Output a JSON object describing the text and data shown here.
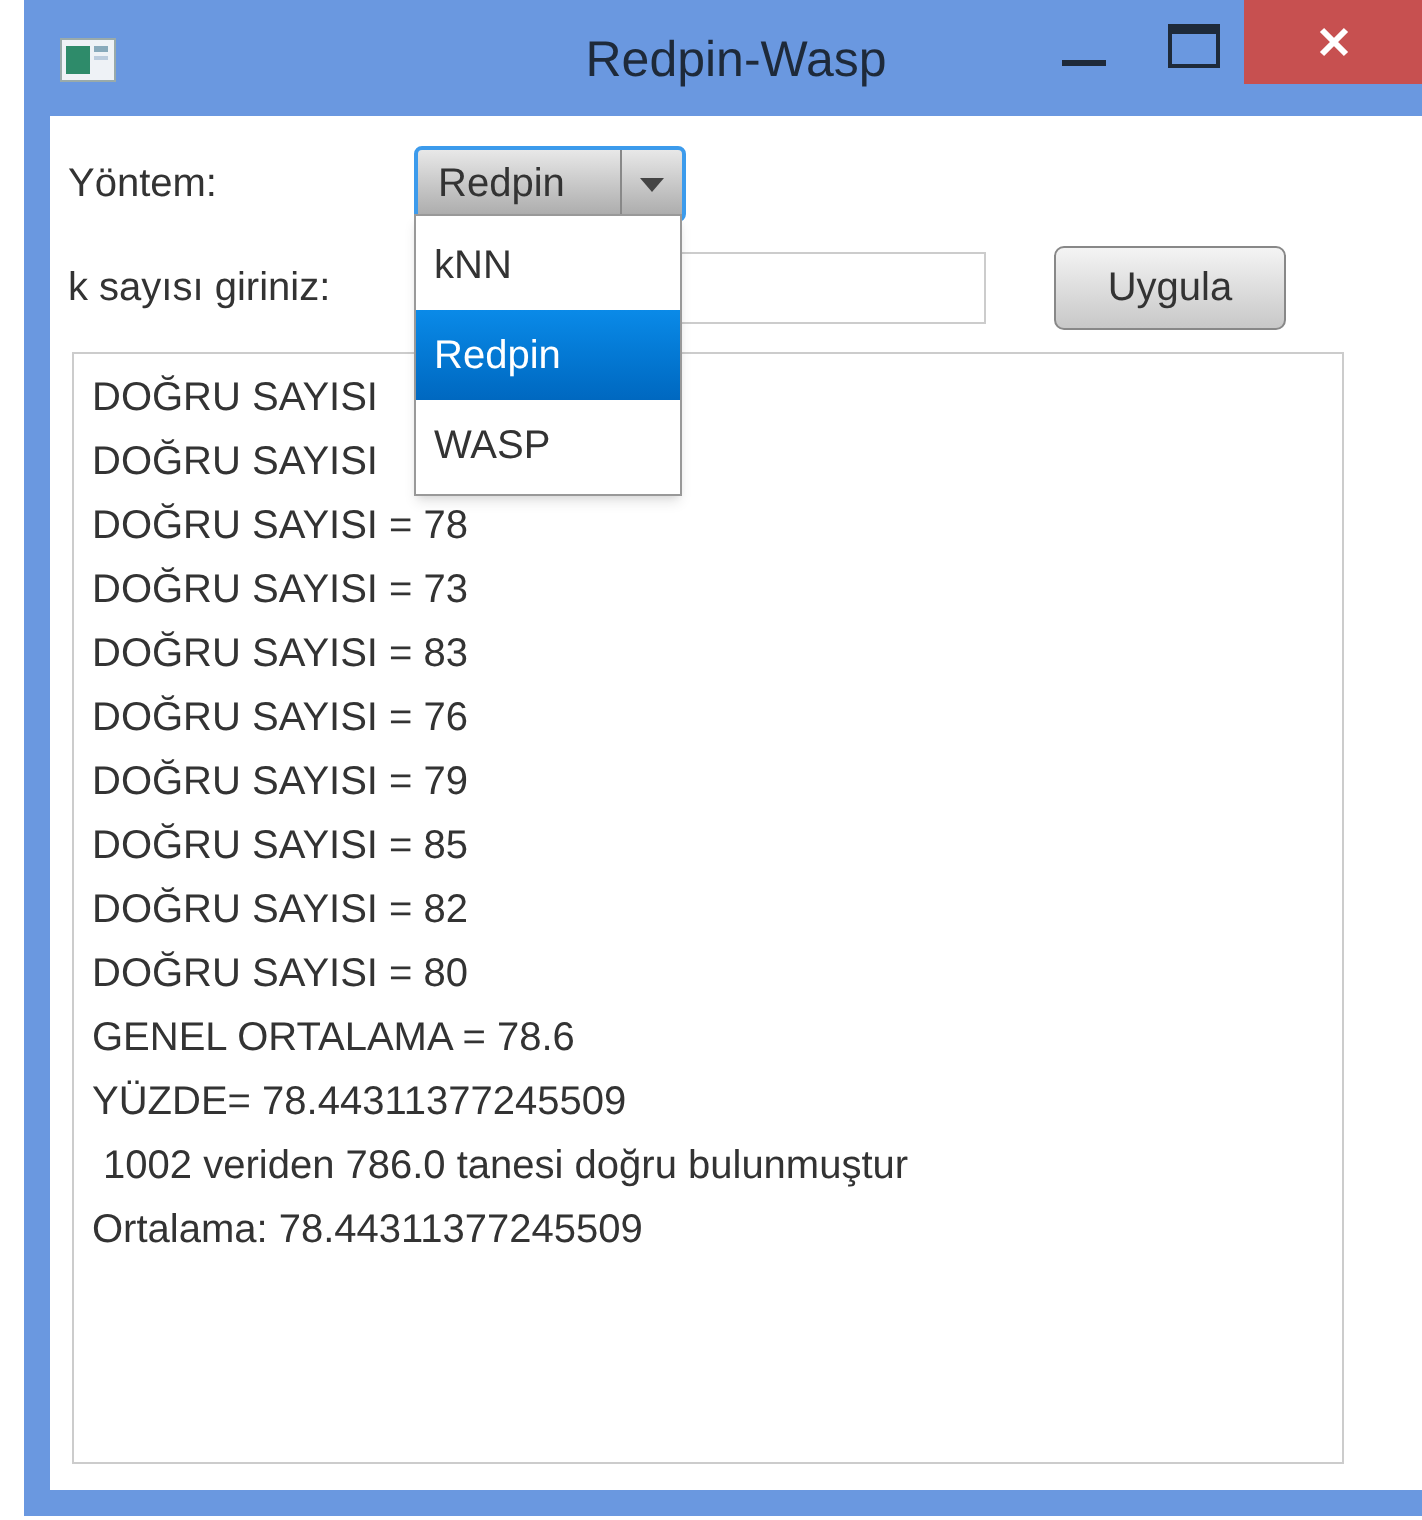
{
  "window": {
    "title": "Redpin-Wasp"
  },
  "method": {
    "label": "Yöntem:",
    "value": "Redpin",
    "expanded": true,
    "options": [
      {
        "label": "kNN",
        "selected": false
      },
      {
        "label": "Redpin",
        "selected": true
      },
      {
        "label": "WASP",
        "selected": false
      }
    ]
  },
  "k_input": {
    "label": "k sayısı giriniz:"
  },
  "apply_button": "Uygula",
  "output_lines": [
    "DOĞRU SAYISI",
    "DOĞRU SAYISI",
    "DOĞRU SAYISI = 78",
    "DOĞRU SAYISI = 73",
    "DOĞRU SAYISI = 83",
    "DOĞRU SAYISI = 76",
    "DOĞRU SAYISI = 79",
    "DOĞRU SAYISI = 85",
    "DOĞRU SAYISI = 82",
    "DOĞRU SAYISI = 80",
    "GENEL ORTALAMA = 78.6",
    "YÜZDE= 78.44311377245509",
    " 1002 veriden 786.0 tanesi doğru bulunmuştur",
    "Ortalama: 78.44311377245509"
  ]
}
